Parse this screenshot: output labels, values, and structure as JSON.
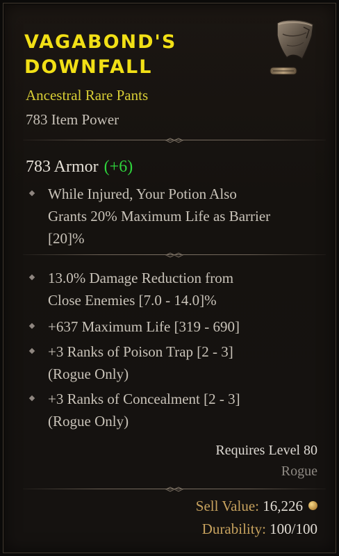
{
  "item": {
    "name_line1": "VAGABOND'S",
    "name_line2": "DOWNFALL",
    "subtype": "Ancestral Rare Pants",
    "item_power": "783 Item Power",
    "armor": "783 Armor",
    "armor_diff": "(+6)",
    "image_icon": "pants-icon"
  },
  "implicit_affixes": [
    {
      "line1": "While Injured, Your Potion Also",
      "line2": "Grants 20% Maximum Life as Barrier",
      "line3": "[20]%"
    }
  ],
  "affixes": [
    {
      "line1": "13.0% Damage Reduction from",
      "line2": "Close Enemies [7.0 - 14.0]%"
    },
    {
      "line1": "+637 Maximum Life [319 - 690]"
    },
    {
      "line1": "+3 Ranks of Poison Trap [2 - 3]",
      "line2": "(Rogue Only)"
    },
    {
      "line1": "+3 Ranks of Concealment [2 - 3]",
      "line2": "(Rogue Only)"
    }
  ],
  "requirements": {
    "level": "Requires Level 80",
    "class": "Rogue"
  },
  "footer": {
    "sell_label": "Sell Value:",
    "sell_value": "16,226",
    "durability_label": "Durability:",
    "durability_value": "100/100"
  },
  "colors": {
    "name": "#f2e016",
    "subtype": "#d8ce35",
    "armor_diff": "#2ed43c",
    "footer_label": "#c7a25e"
  }
}
